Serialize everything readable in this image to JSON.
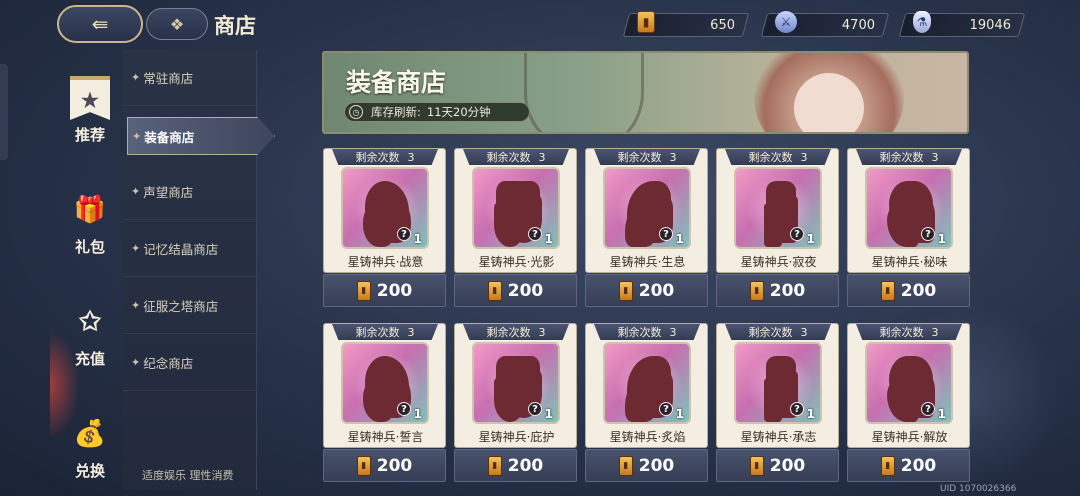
{
  "header": {
    "back_icon": "back-arrow-icon",
    "home_icon": "grid-icon",
    "title": "商店"
  },
  "currencies": [
    {
      "icon": "ticket-icon",
      "value": "650"
    },
    {
      "icon": "sword-icon",
      "value": "4700"
    },
    {
      "icon": "potion-icon",
      "value": "19046"
    }
  ],
  "categories": [
    {
      "label": "推荐",
      "icon": "banner-star-icon"
    },
    {
      "label": "礼包",
      "icon": "gift-icon"
    },
    {
      "label": "充值",
      "icon": "star-icon"
    },
    {
      "label": "兑换",
      "icon": "coin-bag-icon"
    }
  ],
  "submenu": [
    {
      "label": "常驻商店"
    },
    {
      "label": "装备商店",
      "active": true
    },
    {
      "label": "声望商店"
    },
    {
      "label": "记忆结晶商店"
    },
    {
      "label": "征服之塔商店"
    },
    {
      "label": "纪念商店"
    }
  ],
  "footer": "适度娱乐 理性消费",
  "banner": {
    "title": "装备商店",
    "refresh_label": "库存刷新:",
    "refresh_value": "11天20分钟"
  },
  "remain_label": "剩余次数",
  "items": [
    {
      "name": "星铸神兵·战意",
      "remain": "3",
      "qty": "1",
      "price": "200"
    },
    {
      "name": "星铸神兵·光影",
      "remain": "3",
      "qty": "1",
      "price": "200"
    },
    {
      "name": "星铸神兵·生息",
      "remain": "3",
      "qty": "1",
      "price": "200"
    },
    {
      "name": "星铸神兵·寂夜",
      "remain": "3",
      "qty": "1",
      "price": "200"
    },
    {
      "name": "星铸神兵·秘味",
      "remain": "3",
      "qty": "1",
      "price": "200"
    },
    {
      "name": "星铸神兵·誓言",
      "remain": "3",
      "qty": "1",
      "price": "200"
    },
    {
      "name": "星铸神兵·庇护",
      "remain": "3",
      "qty": "1",
      "price": "200"
    },
    {
      "name": "星铸神兵·炙焰",
      "remain": "3",
      "qty": "1",
      "price": "200"
    },
    {
      "name": "星铸神兵·承志",
      "remain": "3",
      "qty": "1",
      "price": "200"
    },
    {
      "name": "星铸神兵·解放",
      "remain": "3",
      "qty": "1",
      "price": "200"
    }
  ],
  "uid": "UID 1070026366"
}
